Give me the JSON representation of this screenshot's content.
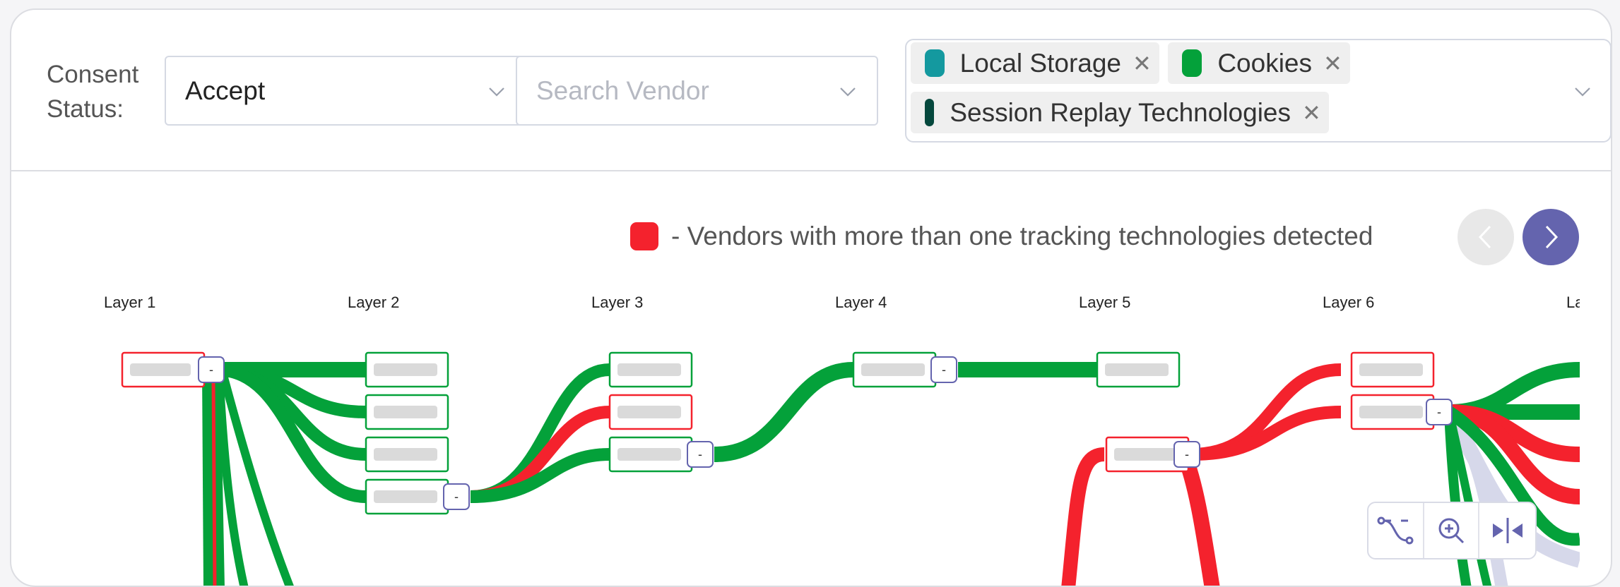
{
  "filters": {
    "consent_label": "Consent Status:",
    "consent_value": "Accept",
    "vendor_placeholder": "Search Vendor",
    "chips": [
      {
        "label": "Local Storage",
        "color": "#14999f"
      },
      {
        "label": "Cookies",
        "color": "#04a13a"
      },
      {
        "label": "Session Replay Technologies",
        "color": "#05483d"
      }
    ]
  },
  "legend": {
    "text": "- Vendors with more than one tracking technologies detected",
    "color": "#f4222d"
  },
  "graph": {
    "layers": [
      "Layer 1",
      "Layer 2",
      "Layer 3",
      "Layer 4",
      "Layer 5",
      "Layer 6",
      "La"
    ],
    "collapse_label": "-",
    "colors": {
      "green": "#04a13a",
      "red": "#f4222d",
      "lavender": "#d6d8ea",
      "accent": "#6464ae"
    }
  },
  "nav": {
    "prev": "<",
    "next": ">"
  }
}
